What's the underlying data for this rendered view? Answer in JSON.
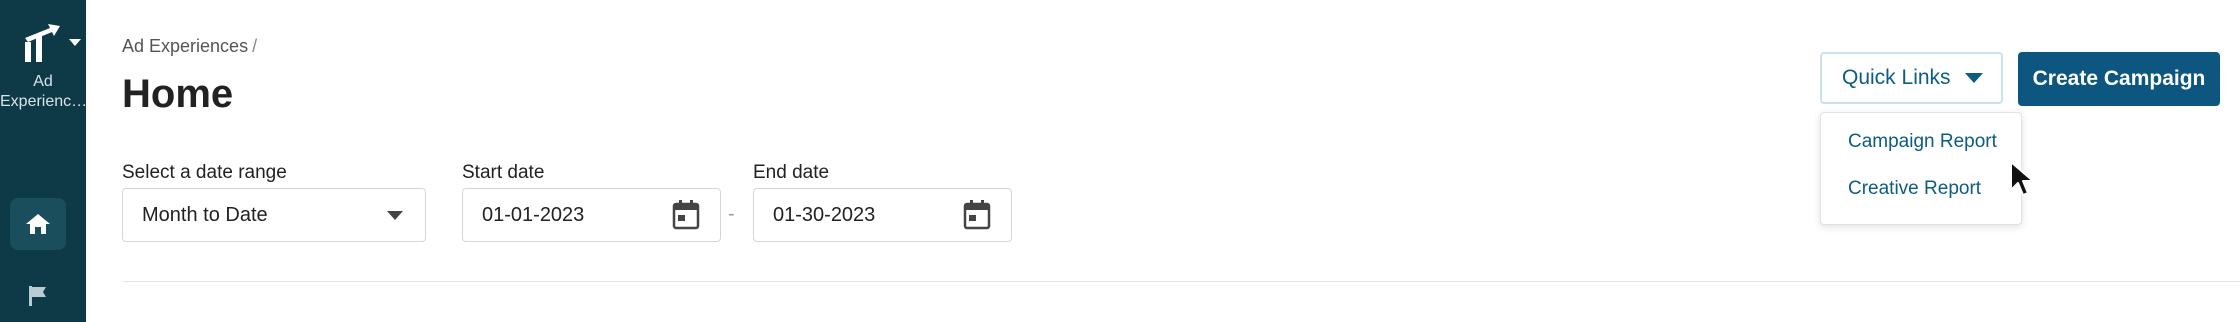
{
  "sidebar": {
    "app_name": "Ad\nExperienc…",
    "items": [
      {
        "icon": "home-icon"
      },
      {
        "icon": "flag-icon"
      }
    ],
    "colors": {
      "background": "#0e3a47",
      "active": "#1a4e5d"
    }
  },
  "header": {
    "breadcrumb": "Ad Experiences",
    "breadcrumb_separator": "/",
    "title": "Home"
  },
  "filters": {
    "date_range": {
      "label": "Select a date range",
      "value": "Month to Date"
    },
    "start_date": {
      "label": "Start date",
      "value": "01-01-2023"
    },
    "range_separator": "-",
    "end_date": {
      "label": "End date",
      "value": "01-30-2023"
    }
  },
  "actions": {
    "quick_links": {
      "label": "Quick Links",
      "items": [
        "Campaign Report",
        "Creative Report"
      ]
    },
    "create_campaign": "Create Campaign"
  },
  "colors": {
    "accent": "#0d5680",
    "link": "#0d5c83"
  }
}
